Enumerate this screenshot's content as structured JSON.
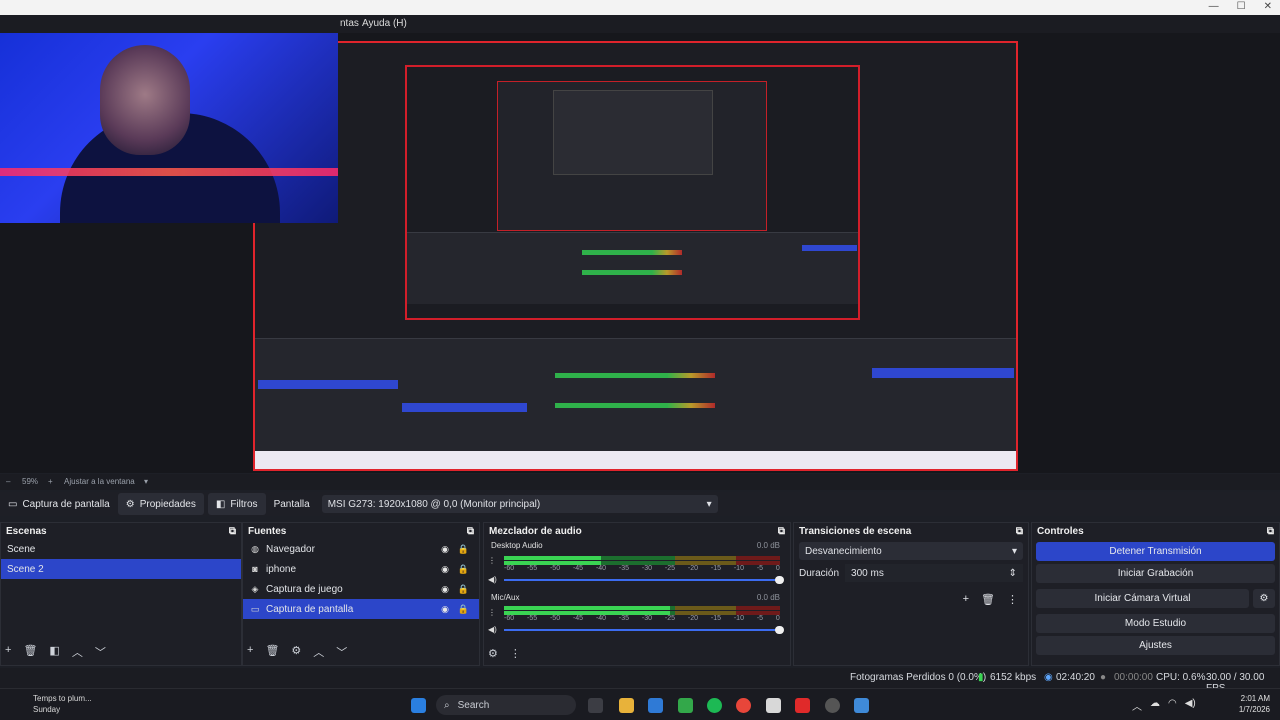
{
  "menu": {
    "partial_left": "ntas",
    "help": "Ayuda (H)"
  },
  "zoom": {
    "percent": "59%",
    "fit": "Ajustar a la ventana"
  },
  "source_toolbar": {
    "source_name": "Captura de pantalla",
    "properties": "Propiedades",
    "filters": "Filtros",
    "screen_label": "Pantalla",
    "screen_value": "MSI G273: 1920x1080 @ 0,0 (Monitor principal)"
  },
  "scenes": {
    "title": "Escenas",
    "items": [
      "Scene",
      "Scene 2"
    ],
    "selected": 1
  },
  "sources": {
    "title": "Fuentes",
    "items": [
      {
        "label": "Navegador",
        "icon": "globe-icon"
      },
      {
        "label": "iphone",
        "icon": "camera-icon"
      },
      {
        "label": "Captura de juego",
        "icon": "gamepad-icon"
      },
      {
        "label": "Captura de pantalla",
        "icon": "monitor-icon"
      }
    ],
    "selected": 3
  },
  "mixer": {
    "title": "Mezclador de audio",
    "ticks": [
      "-60",
      "-55",
      "-50",
      "-45",
      "-40",
      "-35",
      "-30",
      "-25",
      "-20",
      "-15",
      "-10",
      "-5",
      "0"
    ],
    "channels": [
      {
        "name": "Desktop Audio",
        "db": "0.0 dB",
        "level": 0.35
      },
      {
        "name": "Mic/Aux",
        "db": "0.0 dB",
        "level": 0.6
      }
    ]
  },
  "transitions": {
    "title": "Transiciones de escena",
    "selected": "Desvanecimiento",
    "duration_label": "Duración",
    "duration_value": "300 ms"
  },
  "controls": {
    "title": "Controles",
    "buttons": [
      "Detener Transmisión",
      "Iniciar Grabación",
      "Iniciar Cámara Virtual",
      "Modo Estudio",
      "Ajustes"
    ]
  },
  "status": {
    "dropped": "Fotogramas Perdidos 0 (0.0%)",
    "bitrate": "6152 kbps",
    "stream_time": "02:40:20",
    "rec_time": "00:00:00",
    "cpu": "CPU: 0.6%",
    "fps": "30.00 / 30.00 FPS"
  },
  "taskbar": {
    "notif_title": "Temps to plum...",
    "notif_sub": "Sunday",
    "search": "Search",
    "time": "2:01 AM",
    "date": "1/7/2026"
  },
  "colors": {
    "accent": "#2c46c9",
    "record_red": "#e0242c",
    "meter_green": "#3ad453"
  }
}
